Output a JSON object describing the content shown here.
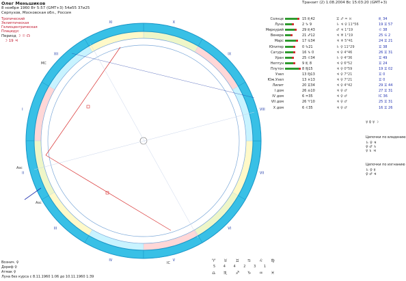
{
  "header": {
    "name": "Олег Меньшиков",
    "date_line": "8 ноября 1960  Вт  5:57 (GMT+3)  54и55  37и25",
    "place": "Серпухов, Московская обл., Россия",
    "systems": [
      "Тропический",
      "Эклиптическая",
      "Гелиоцентрическая",
      "Плацидус"
    ],
    "period_label": "Период",
    "period_value": "19",
    "transit": "Транзит (2)  1.08.2004  Вс 15:03:20 (GMT+3)"
  },
  "planets": [
    {
      "name": "Солнце",
      "bar": 18,
      "deg": "15 ♏42",
      "asp": "♊ ♐ ♒ ♓",
      "house": "♏ 34"
    },
    {
      "name": "Луна",
      "bar": 10,
      "deg": "2 ♑ 9",
      "asp": "♄ ♃ ♀ 11°56",
      "house": "19 ♊ 57"
    },
    {
      "name": "Меркурий",
      "bar": 14,
      "deg": "29 ♏43",
      "asp": "♂ ♃ 1°19",
      "house": "♌ 38"
    },
    {
      "name": "Венера",
      "bar": 8,
      "deg": "21 ♐12",
      "asp": "♃ ♅ 1°19",
      "house": "25 ♋ 2"
    },
    {
      "name": "Марс",
      "bar": 16,
      "deg": "17 ♋34",
      "asp": "♃ ♆ 5°41",
      "house": "24 ♊ 21"
    },
    {
      "name": "Юпитер",
      "bar": 12,
      "deg": "0 ♑21",
      "asp": "♄ ♀ 11°29",
      "house": "♊ 38"
    },
    {
      "name": "Сатурн",
      "bar": 12,
      "deg": "16 ♑ 0",
      "asp": "♃ ♀ 4°46",
      "house": "26 ♊ 31"
    },
    {
      "name": "Уран",
      "bar": 10,
      "deg": "25 ♌34",
      "asp": "♄ ♀ 4°36",
      "house": "♊ 49"
    },
    {
      "name": "Нептун",
      "bar": 12,
      "deg": "9 ♏ 8",
      "asp": "♃ ♀ 6°52",
      "house": "♊ 24"
    },
    {
      "name": "Плутон",
      "bar": 20,
      "deg": "8 ♍15",
      "asp": "♃ ♀ 0°59",
      "house": "19 ♊ 02"
    },
    {
      "name": "Узел",
      "bar": 0,
      "deg": "13 ♍13",
      "asp": "♃ ♀ 7°21",
      "house": "♊ 0"
    },
    {
      "name": "Юж.Узел",
      "bar": 0,
      "deg": "13 ♓13",
      "asp": "♃ ♀ 7°21",
      "house": "♊ 0"
    },
    {
      "name": "Лилит",
      "bar": 0,
      "deg": "20 ♊34",
      "asp": "♃ ♀ 4°42",
      "house": "29 ♊ 44"
    },
    {
      "name": "I дом",
      "bar": 0,
      "deg": "26 ♎10",
      "asp": "♃ ♀ ♂",
      "house": "27 ♊ 31"
    },
    {
      "name": "IV дом",
      "bar": 0,
      "deg": "6 ♒35",
      "asp": "♃ ♀ ♂",
      "house": "IC 36"
    },
    {
      "name": "VII дом",
      "bar": 0,
      "deg": "26 ♈10",
      "asp": "♃ ♀ ♂",
      "house": "25 ♊ 31"
    },
    {
      "name": "X дом",
      "bar": 0,
      "deg": "6 ♌35",
      "asp": "♃ ♀ ♂",
      "house": "16 ♊ 26"
    }
  ],
  "right_sections": {
    "rulership": "Цепочки по владению",
    "exaltation": "Цепочки по изгнанию"
  },
  "footer": {
    "lines": [
      "Вознич. ♀",
      "Дориф ♀",
      "Атмак ♀",
      "Луна без курса с 8.11.1960  1:06 до 10.11.1960  1:39"
    ]
  },
  "houses": [
    "I",
    "II",
    "III",
    "IV",
    "V",
    "VI",
    "VII",
    "VIII",
    "IX",
    "X",
    "XI",
    "XII"
  ],
  "asc_label": "Asc",
  "mc_label": "MC",
  "dsc_label": "Dsc",
  "ic_label": "IC"
}
